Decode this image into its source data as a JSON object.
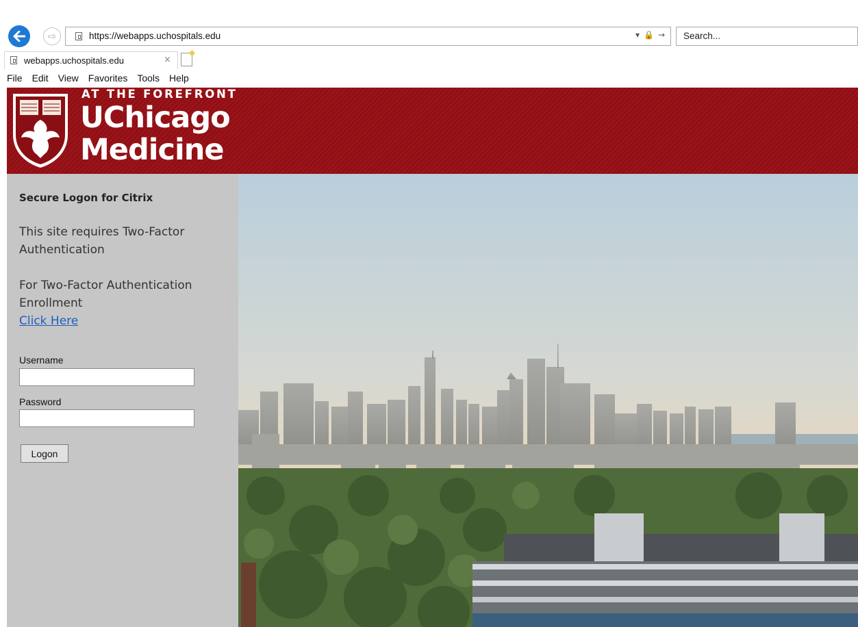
{
  "browser": {
    "url": "https://webapps.uchospitals.edu",
    "search_placeholder": "Search...",
    "tab_title": "webapps.uchospitals.edu",
    "tab_close": "×",
    "menu": [
      "File",
      "Edit",
      "View",
      "Favorites",
      "Tools",
      "Help"
    ],
    "address_tools": [
      "▾",
      "🔒",
      "→"
    ]
  },
  "banner": {
    "tagline": "AT THE FOREFRONT",
    "name_line1": "UChicago",
    "name_line2": "Medicine",
    "crest_text": [
      "crescat",
      "scientia",
      "vita",
      "excolatur"
    ],
    "color": "#9b141a"
  },
  "login": {
    "title": "Secure Logon for Citrix",
    "requirement_text": "This site requires Two-Factor Authentication",
    "enrollment_text": "For Two-Factor Authentication Enrollment",
    "enrollment_link": "Click Here",
    "username_label": "Username",
    "username_value": "",
    "password_label": "Password",
    "password_value": "",
    "logon_button": "Logon"
  }
}
